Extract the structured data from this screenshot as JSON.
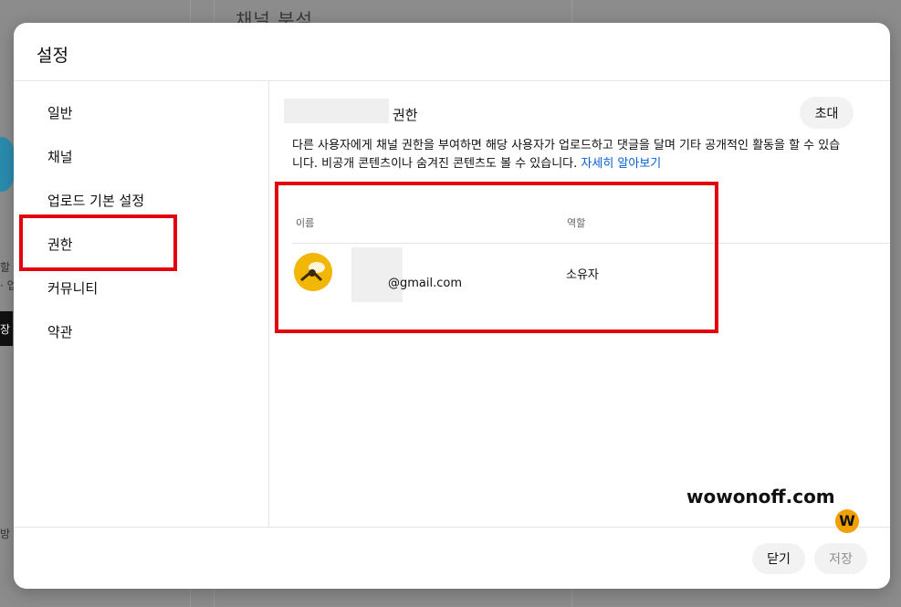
{
  "background": {
    "page_title": "채널 분석",
    "left_snippets": [
      "할 ",
      "· 업",
      "장",
      "방"
    ]
  },
  "dialog": {
    "title": "설정",
    "nav": [
      {
        "label": "일반"
      },
      {
        "label": "채널"
      },
      {
        "label": "업로드 기본 설정"
      },
      {
        "label": "권한",
        "selected": true
      },
      {
        "label": "커뮤니티"
      },
      {
        "label": "약관"
      }
    ],
    "permissions": {
      "title": "권한",
      "invite_label": "초대",
      "description": "다른 사용자에게 채널 권한을 부여하면 해당 사용자가 업로드하고 댓글을 달며 기타 공개적인 활동을 할 수 있습니다. 비공개 콘텐츠이나 숨겨진 콘텐츠도 볼 수 있습니다. ",
      "learn_more": "자세히 알아보기",
      "columns": {
        "name": "이름",
        "role": "역할"
      },
      "rows": [
        {
          "email": "@gmail.com",
          "role": "소유자",
          "avatar": "bee-avatar-icon"
        }
      ]
    },
    "footer": {
      "close_label": "닫기",
      "save_label": "저장"
    }
  },
  "watermark": {
    "text_dark": "wowonoff.com",
    "badge": "W"
  },
  "colors": {
    "highlight": "#e3000f",
    "link": "#065fd4",
    "avatar": "#f2b705"
  }
}
